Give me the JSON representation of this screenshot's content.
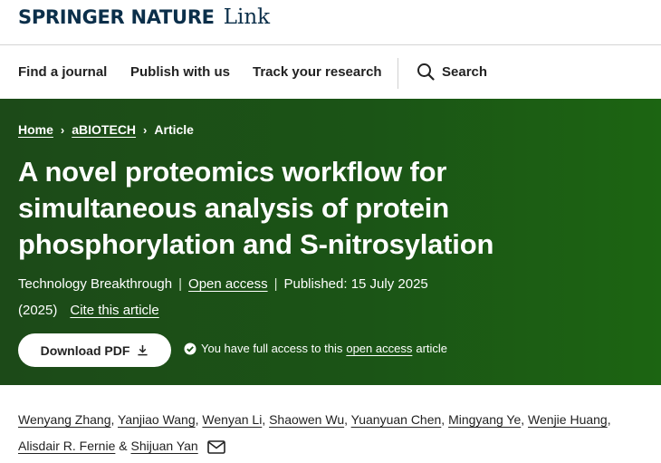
{
  "brand": {
    "name": "SPRINGER NATURE",
    "sub": "Link"
  },
  "nav": {
    "find_journal": "Find a journal",
    "publish": "Publish with us",
    "track": "Track your research",
    "search": "Search"
  },
  "breadcrumb": {
    "home": "Home",
    "journal": "aBIOTECH",
    "current": "Article",
    "separator": "›"
  },
  "article": {
    "title": "A novel proteomics workflow for simultaneous analysis of protein phosphorylation and S-nitrosylation",
    "type": "Technology Breakthrough",
    "open_access": "Open access",
    "published": "Published: 15 July 2025",
    "year": "(2025)",
    "cite": "Cite this article",
    "separator": "|"
  },
  "actions": {
    "download": "Download PDF",
    "access_prefix": "You have full access to this",
    "access_link": "open access",
    "access_suffix": "article"
  },
  "authors": [
    "Wenyang Zhang",
    "Yanjiao Wang",
    "Wenyan Li",
    "Shaowen Wu",
    "Yuanyuan Chen",
    "Mingyang Ye",
    "Wenjie Huang",
    "Alisdair R. Fernie",
    "Shijuan Yan"
  ],
  "authors_punct": {
    "comma": ",",
    "and": "&"
  },
  "colors": {
    "hero_start": "#1c4a18",
    "hero_end": "#1c6512",
    "brand": "#0b2f4a"
  },
  "icons": {
    "search": "search-icon",
    "download": "download-icon",
    "access": "check-circle-icon",
    "mail": "mail-icon"
  }
}
